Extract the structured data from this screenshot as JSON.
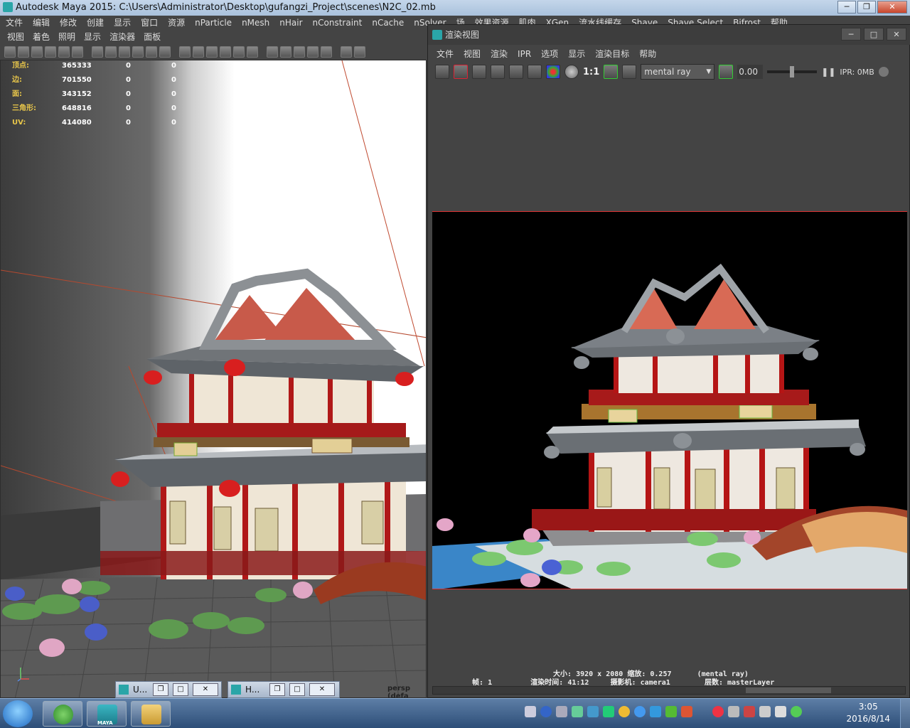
{
  "maya": {
    "title": "Autodesk Maya 2015: C:\\Users\\Administrator\\Desktop\\gufangzi_Project\\scenes\\N2C_02.mb",
    "menu": [
      "文件",
      "编辑",
      "修改",
      "创建",
      "显示",
      "窗口",
      "资源",
      "nParticle",
      "nMesh",
      "nHair",
      "nConstraint",
      "nCache",
      "nSolver",
      "场",
      "效果资源",
      "肌肉",
      "XGen",
      "流水线缓存",
      "Shave",
      "Shave Select",
      "Bifrost",
      "帮助"
    ]
  },
  "viewport": {
    "menu": [
      "视图",
      "着色",
      "照明",
      "显示",
      "渲染器",
      "面板"
    ],
    "hud": [
      {
        "label": "顶点:",
        "value": "365333",
        "a": "0",
        "b": "0"
      },
      {
        "label": "边:",
        "value": "701550",
        "a": "0",
        "b": "0"
      },
      {
        "label": "面:",
        "value": "343152",
        "a": "0",
        "b": "0"
      },
      {
        "label": "三角形:",
        "value": "648816",
        "a": "0",
        "b": "0"
      },
      {
        "label": "UV:",
        "value": "414080",
        "a": "0",
        "b": "0"
      }
    ],
    "camera_label": "persp (defa",
    "minimized": [
      {
        "label": "U..."
      },
      {
        "label": "H..."
      }
    ]
  },
  "render_view": {
    "title": "渲染视图",
    "menu": [
      "文件",
      "视图",
      "渲染",
      "IPR",
      "选项",
      "显示",
      "渲染目标",
      "帮助"
    ],
    "ratio": "1:1",
    "renderer": "mental ray",
    "exposure": "0.00",
    "ipr": "IPR: 0MB",
    "status": {
      "size_label": "大小:",
      "size": "3920 x 2080",
      "zoom_label": "缩放:",
      "zoom": "0.257",
      "renderer_tag": "(mental ray)",
      "frame_label": "帧:",
      "frame": "1",
      "time_label": "渲染时间:",
      "time": "41:12",
      "camera_label": "摄影机:",
      "camera": "camera1",
      "layer_label": "层数:",
      "layer": "masterLayer"
    }
  },
  "taskbar": {
    "time": "3:05",
    "date": "2016/8/14",
    "maya_label": "MAYA"
  },
  "colors": {
    "accent_red": "#cc2222",
    "maya_teal": "#2aa5a8",
    "taskbar": "#2d4e78"
  }
}
